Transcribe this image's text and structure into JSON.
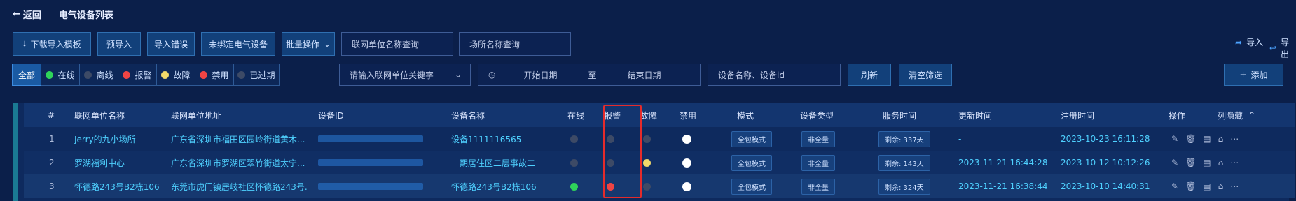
{
  "header": {
    "back_label": "返回",
    "page_title": "电气设备列表"
  },
  "toolbar": {
    "download_template": "下载导入模板",
    "pre_import": "预导入",
    "import_errors": "导入错误",
    "unbound_devices": "未绑定电气设备",
    "batch_ops": "批量操作",
    "unit_search_placeholder": "联网单位名称查询",
    "site_search_placeholder": "场所名称查询",
    "import": "导入",
    "export": "导出"
  },
  "filters": {
    "all": "全部",
    "online": "在线",
    "offline": "离线",
    "alarm": "报警",
    "fault": "故障",
    "disabled": "禁用",
    "expired": "已过期",
    "unit_keyword_placeholder": "请输入联网单位关键字",
    "start_date": "开始日期",
    "to": "至",
    "end_date": "结束日期",
    "device_search_placeholder": "设备名称、设备id",
    "refresh": "刷新",
    "clear": "清空筛选",
    "add": "添加"
  },
  "colors": {
    "online": "#2fd35a",
    "offline": "#3d4a66",
    "alarm": "#ef4444",
    "fault": "#f1d96a",
    "disabled_filter": "#ef4444",
    "disabled_cell": "#ffffff",
    "highlight_box": "#e52b2b"
  },
  "table": {
    "headers": {
      "index": "#",
      "unit_name": "联网单位名称",
      "unit_address": "联网单位地址",
      "device_id": "设备ID",
      "device_name": "设备名称",
      "online": "在线",
      "alarm": "报警",
      "fault": "故障",
      "disabled": "禁用",
      "mode": "模式",
      "device_type": "设备类型",
      "service_time": "服务时间",
      "update_time": "更新时间",
      "register_time": "注册时间",
      "actions": "操作",
      "hide_columns": "列隐藏"
    },
    "rows": [
      {
        "index": "1",
        "unit_name": "Jerry的九小场所",
        "unit_address": "广东省深圳市福田区园岭街道黄木...",
        "device_name": "设备1111116565",
        "online": "offline",
        "alarm": "offline",
        "fault": "offline",
        "disabled": "white",
        "mode": "全包模式",
        "device_type": "非全量",
        "service_time": "剩余: 337天",
        "update_time": "-",
        "register_time": "2023-10-23 16:11:28"
      },
      {
        "index": "2",
        "unit_name": "罗湖福利中心",
        "unit_address": "广东省深圳市罗湖区翠竹街道太宁...",
        "device_name": "一期居住区二层事故二",
        "online": "offline",
        "alarm": "offline",
        "fault": "yellow",
        "disabled": "white",
        "mode": "全包模式",
        "device_type": "非全量",
        "service_time": "剩余: 143天",
        "update_time": "2023-11-21 16:44:28",
        "register_time": "2023-10-12 10:12:26"
      },
      {
        "index": "3",
        "unit_name": "怀德路243号B2栋106",
        "unit_address": "东莞市虎门镇居岐社区怀德路243号...",
        "device_name": "怀德路243号B2栋106",
        "online": "green",
        "alarm": "red",
        "fault": "offline",
        "disabled": "white",
        "mode": "全包模式",
        "device_type": "非全量",
        "service_time": "剩余: 324天",
        "update_time": "2023-11-21 16:38:44",
        "register_time": "2023-10-10 14:40:31"
      }
    ]
  }
}
